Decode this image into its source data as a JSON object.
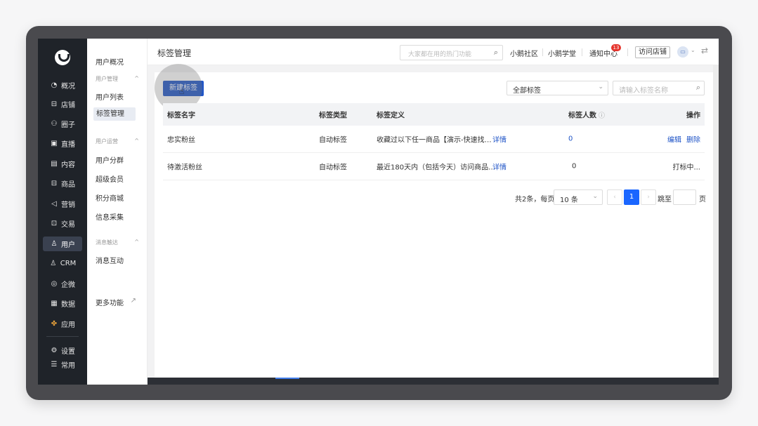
{
  "sidebar": {
    "items": [
      {
        "icon": "◔",
        "label": "概况"
      },
      {
        "icon": "⊟",
        "label": "店铺"
      },
      {
        "icon": "⚇",
        "label": "圈子"
      },
      {
        "icon": "▣",
        "label": "直播"
      },
      {
        "icon": "▤",
        "label": "内容"
      },
      {
        "icon": "⊟",
        "label": "商品"
      },
      {
        "icon": "◁",
        "label": "营销"
      },
      {
        "icon": "⊡",
        "label": "交易"
      },
      {
        "icon": "♙",
        "label": "用户"
      },
      {
        "icon": "♙",
        "label": "CRM"
      },
      {
        "icon": "◎",
        "label": "企微"
      },
      {
        "icon": "▦",
        "label": "数据"
      },
      {
        "icon": "✤",
        "label": "应用"
      },
      {
        "icon": "⚙",
        "label": "设置"
      },
      {
        "icon": "☰",
        "label": "常用"
      }
    ]
  },
  "subnav": {
    "overview": "用户概况",
    "group1": "用户管理",
    "user_list": "用户列表",
    "tag_manage": "标签管理",
    "group2": "用户运营",
    "user_segment": "用户分群",
    "super_member": "超级会员",
    "points_mall": "积分商城",
    "info_collect": "信息采集",
    "group3": "消息触达",
    "msg_interact": "消息互动",
    "more": "更多功能",
    "collapse_glyph": "^",
    "external_glyph": "↗"
  },
  "topbar": {
    "title": "标签管理",
    "search_placeholder": "大家都在用的热门功能",
    "link_community": "小鹅社区",
    "link_school": "小鹅学堂",
    "notify": "通知中心",
    "notify_count": "13",
    "visit_shop": "访问店铺",
    "avatar_glyph": "▭",
    "caret": "⌄",
    "switch_glyph": "⇄"
  },
  "toolbar": {
    "new_tag": "新建标签",
    "filter_value": "全部标签",
    "tag_search_placeholder": "请输入标签名称"
  },
  "table": {
    "headers": {
      "name": "标签名字",
      "type": "标签类型",
      "definition": "标签定义",
      "count": "标签人数",
      "actions": "操作"
    },
    "rows": [
      {
        "name": "忠实粉丝",
        "type": "自动标签",
        "definition": "收藏过以下任一商品【演示-快速找…",
        "detail": "详情",
        "count": "0",
        "edit": "编辑",
        "delete": "删除",
        "status": ""
      },
      {
        "name": "待激活粉丝",
        "type": "自动标签",
        "definition": "最近180天内（包括今天）访问商品…",
        "detail": "详情",
        "count": "0",
        "edit": "",
        "delete": "",
        "status": "打标中..."
      }
    ]
  },
  "pagination": {
    "total": "共2条，每页",
    "page_size": "10 条",
    "current": "1",
    "jump_to": "跳至",
    "page_unit": "页",
    "prev_glyph": "‹",
    "next_glyph": "›"
  }
}
